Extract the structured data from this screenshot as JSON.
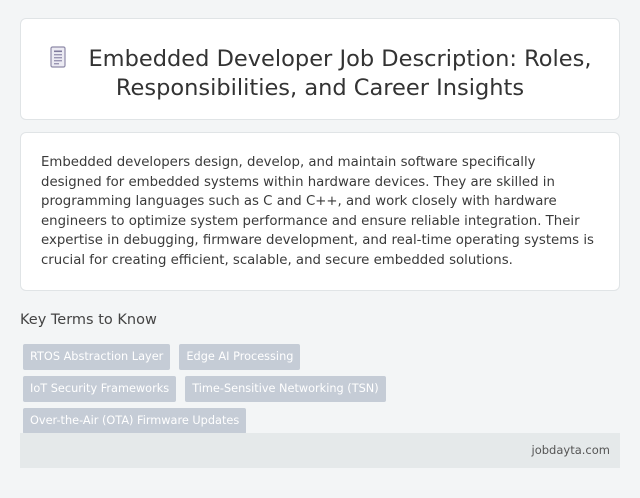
{
  "header": {
    "title": "Embedded Developer Job Description: Roles, Responsibilities, and Career Insights",
    "icon": "document-icon"
  },
  "description": {
    "text": "Embedded developers design, develop, and maintain software specifically designed for embedded systems within hardware devices. They are skilled in programming languages such as C and C++, and work closely with hardware engineers to optimize system performance and ensure reliable integration. Their expertise in debugging, firmware development, and real-time operating systems is crucial for creating efficient, scalable, and secure embedded solutions."
  },
  "key_terms": {
    "heading": "Key Terms to Know",
    "tags": [
      "RTOS Abstraction Layer",
      "Edge AI Processing",
      "IoT Security Frameworks",
      "Time-Sensitive Networking (TSN)",
      "Over-the-Air (OTA) Firmware Updates"
    ]
  },
  "footer": {
    "site": "jobdayta.com"
  },
  "colors": {
    "background": "#f3f5f6",
    "card": "#ffffff",
    "tag": "#c5ccd6",
    "footer": "#e5e9ea"
  }
}
